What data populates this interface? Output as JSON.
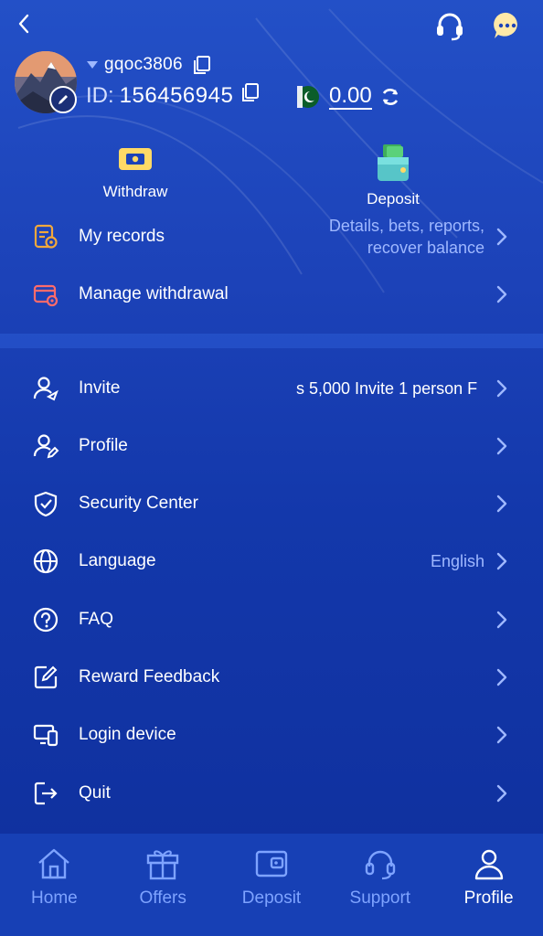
{
  "header": {
    "back_icon": "chevron-left-icon",
    "support_icon": "headset-icon",
    "chat_icon": "chat-bubble-icon"
  },
  "profile": {
    "username": "gqoc3806",
    "id_label": "ID:",
    "id_value": "156456945",
    "balance": "0.00",
    "currency_icon": "pakistan-flag-icon"
  },
  "quick_actions": [
    {
      "label": "Withdraw",
      "icon": "withdraw-ticket-icon"
    },
    {
      "label": "Deposit",
      "icon": "wallet-money-icon"
    }
  ],
  "menu_top": [
    {
      "label": "My records",
      "right": "Details, bets, reports,",
      "right2": "recover balance",
      "icon": "records-icon"
    },
    {
      "label": "Manage withdrawal",
      "right": "",
      "icon": "withdrawal-card-icon"
    }
  ],
  "menu": [
    {
      "label": "Invite",
      "right": "s 5,000  Invite 1 person F",
      "icon": "invite-user-icon"
    },
    {
      "label": "Profile",
      "right": "",
      "icon": "profile-edit-icon"
    },
    {
      "label": "Security Center",
      "right": "",
      "icon": "shield-check-icon"
    },
    {
      "label": "Language",
      "right": "English",
      "icon": "globe-icon"
    },
    {
      "label": "FAQ",
      "right": "",
      "icon": "question-circle-icon"
    },
    {
      "label": "Reward Feedback",
      "right": "",
      "icon": "edit-square-icon"
    },
    {
      "label": "Login device",
      "right": "",
      "icon": "devices-icon"
    },
    {
      "label": "Quit",
      "right": "",
      "icon": "logout-icon"
    }
  ],
  "bottom_nav": [
    {
      "label": "Home",
      "icon": "home-icon",
      "active": false
    },
    {
      "label": "Offers",
      "icon": "gift-icon",
      "active": false
    },
    {
      "label": "Deposit",
      "icon": "wallet-icon",
      "active": false
    },
    {
      "label": "Support",
      "icon": "headset-icon",
      "active": false
    },
    {
      "label": "Profile",
      "icon": "user-icon",
      "active": true
    }
  ],
  "colors": {
    "accent_text": "#9fb8ff",
    "nav_inactive": "#7ea3ff",
    "background": "#1338ab"
  }
}
